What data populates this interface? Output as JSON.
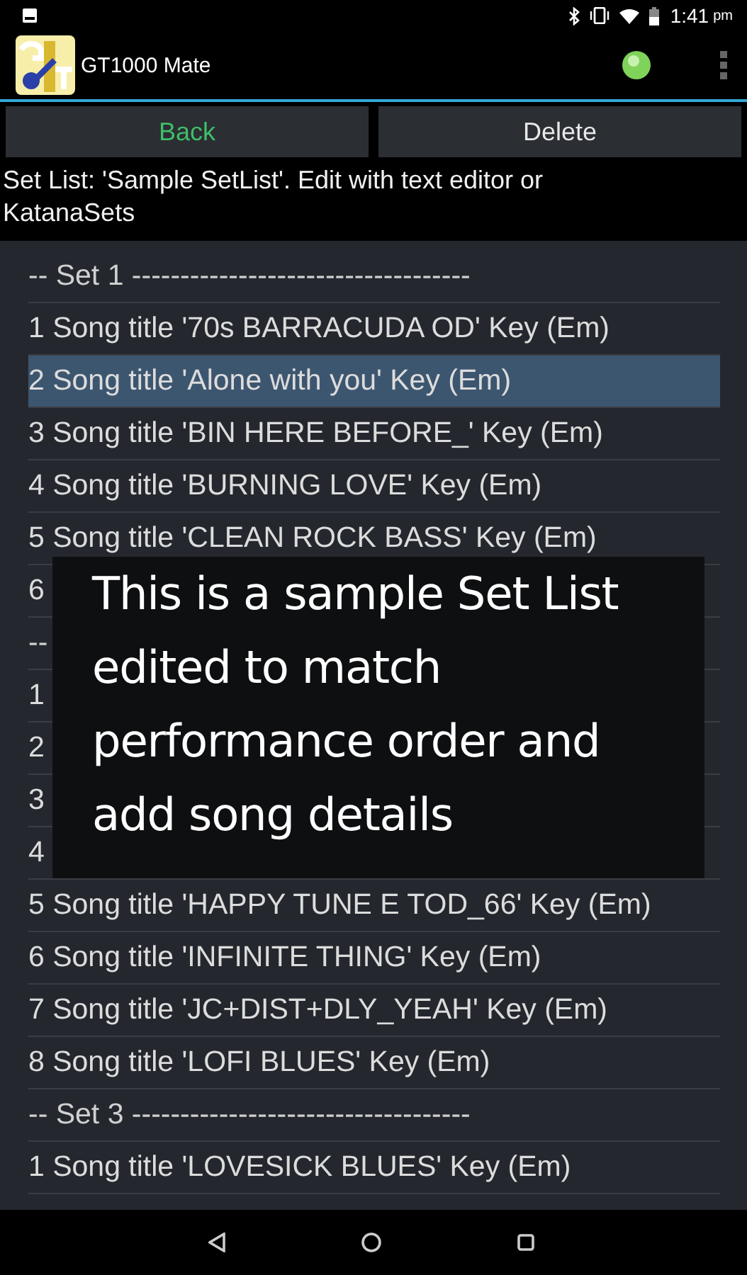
{
  "status_bar": {
    "time": "1:41",
    "period": "pm"
  },
  "app_bar": {
    "title": "GT1000 Mate",
    "connected": true
  },
  "buttons": [
    {
      "label": "Back",
      "kind": "accent"
    },
    {
      "label": "Delete",
      "kind": "plain"
    }
  ],
  "description": "Set List: 'Sample SetList'. Edit with text editor or KatanaSets",
  "rows": [
    {
      "kind": "header",
      "text": "-- Set 1 -----------------------------------",
      "selected": false
    },
    {
      "kind": "song",
      "text": "1 Song title '70s BARRACUDA OD' Key (Em)",
      "selected": false
    },
    {
      "kind": "song",
      "text": "2 Song title 'Alone with you' Key (Em)",
      "selected": true
    },
    {
      "kind": "song",
      "text": "3 Song title 'BIN HERE BEFORE_' Key (Em)",
      "selected": false
    },
    {
      "kind": "song",
      "text": "4 Song title 'BURNING LOVE' Key (Em)",
      "selected": false
    },
    {
      "kind": "song",
      "text": "5 Song title 'CLEAN ROCK BASS' Key (Em)",
      "selected": false
    },
    {
      "kind": "song",
      "text": "6",
      "selected": false
    },
    {
      "kind": "header",
      "text": "--",
      "selected": false
    },
    {
      "kind": "song",
      "text": "1",
      "selected": false
    },
    {
      "kind": "song",
      "text": "2",
      "selected": false
    },
    {
      "kind": "song",
      "text": "3",
      "selected": false
    },
    {
      "kind": "song",
      "text": "4",
      "selected": false
    },
    {
      "kind": "song",
      "text": "5 Song title 'HAPPY TUNE E TOD_66' Key (Em)",
      "selected": false
    },
    {
      "kind": "song",
      "text": "6 Song title 'INFINITE THING' Key (Em)",
      "selected": false
    },
    {
      "kind": "song",
      "text": "7 Song title 'JC+DIST+DLY_YEAH' Key (Em)",
      "selected": false
    },
    {
      "kind": "song",
      "text": "8 Song title 'LOFI BLUES' Key (Em)",
      "selected": false
    },
    {
      "kind": "header",
      "text": "-- Set 3 -----------------------------------",
      "selected": false
    },
    {
      "kind": "song",
      "text": "1 Song title 'LOVESICK BLUES' Key (Em)",
      "selected": false
    }
  ],
  "caption": "This is a sample Set List edited to match performance order and add song details"
}
